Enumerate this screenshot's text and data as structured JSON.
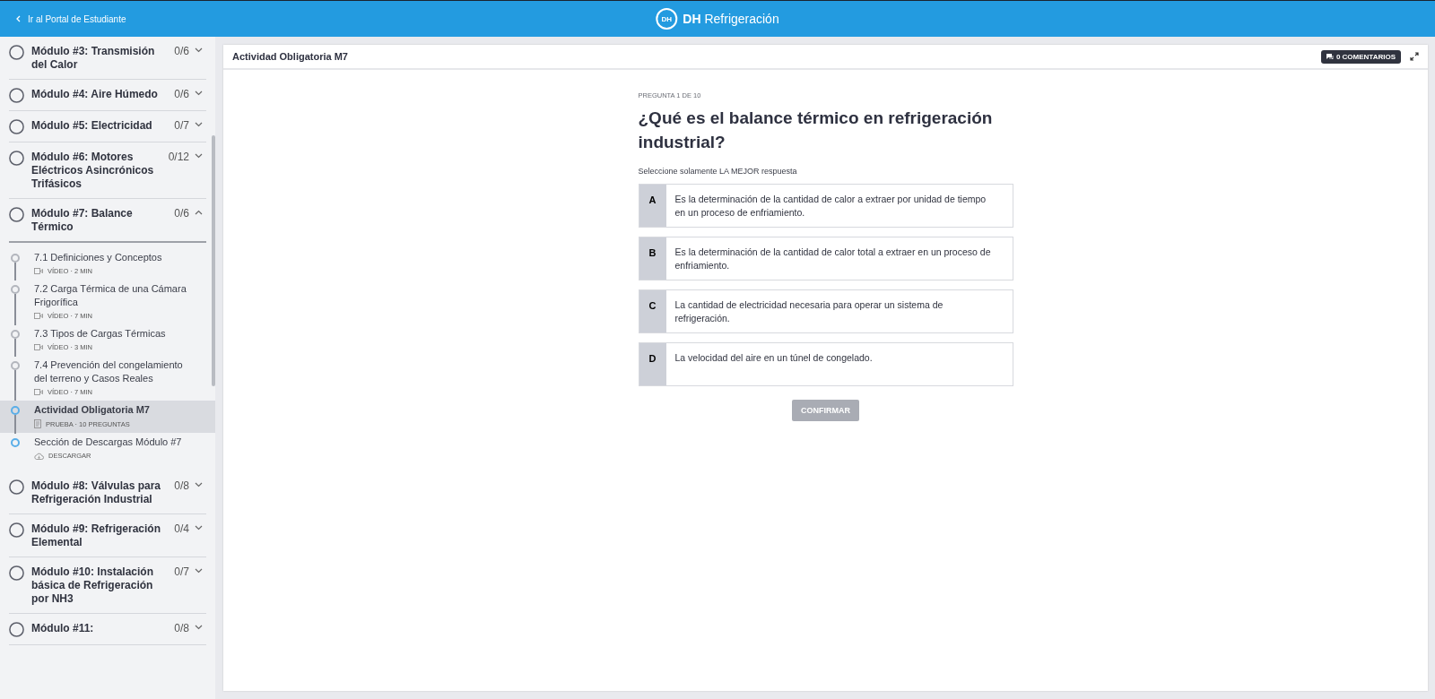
{
  "topbar": {
    "back_link": "Ir al Portal de Estudiante",
    "brand_mark": "DH",
    "brand_bold": "DH",
    "brand_name": "Refrigeración"
  },
  "sidebar": {
    "modules": [
      {
        "title": "Módulo #3: Transmisión del Calor",
        "count": "0/6",
        "level": 0,
        "expanded": false
      },
      {
        "title": "Módulo #4: Aire Húmedo",
        "count": "0/6",
        "level": 0,
        "expanded": false
      },
      {
        "title": "Módulo #5: Electricidad",
        "count": "0/7",
        "level": 0,
        "expanded": false
      },
      {
        "title": "Módulo #6: Motores Eléctricos Asincrónicos Trifásicos",
        "count": "0/12",
        "level": 0,
        "expanded": false
      },
      {
        "title": "Módulo #7: Balance Térmico",
        "count": "0/6",
        "level": 0,
        "expanded": true,
        "children": [
          {
            "kind": "video",
            "title": "7.1 Definiciones y Conceptos",
            "meta": "VÍDEO · 2 MIN",
            "selected": false,
            "color": "#b3b6bd"
          },
          {
            "kind": "video",
            "title": "7.2 Carga Térmica de una Cámara Frigorífica",
            "meta": "VÍDEO · 7 MIN",
            "selected": false,
            "color": "#b3b6bd"
          },
          {
            "kind": "video",
            "title": "7.3 Tipos de Cargas Térmicas",
            "meta": "VÍDEO · 3 MIN",
            "selected": false,
            "color": "#b3b6bd"
          },
          {
            "kind": "video",
            "title": "7.4 Prevención del congelamiento del terreno y Casos Reales",
            "meta": "VÍDEO · 7 MIN",
            "selected": false,
            "color": "#b3b6bd"
          },
          {
            "kind": "quiz",
            "title": "Actividad Obligatoria M7",
            "meta": "PRUEBA · 10 PREGUNTAS",
            "selected": true,
            "color": "#5aaee8"
          },
          {
            "kind": "download",
            "title": "Sección de Descargas Módulo #7",
            "meta": "DESCARGAR",
            "selected": false,
            "color": "#5aaee8"
          }
        ]
      },
      {
        "title": "Módulo #8: Válvulas para Refrigeración Industrial",
        "count": "0/8",
        "level": 0,
        "expanded": false
      },
      {
        "title": "Módulo #9: Refrigeración Elemental",
        "count": "0/4",
        "level": 0,
        "expanded": false
      },
      {
        "title": "Módulo #10: Instalación básica de Refrigeración por NH3",
        "count": "0/7",
        "level": 0,
        "expanded": false
      },
      {
        "title": "Módulo #11:",
        "count": "0/8",
        "level": 0,
        "expanded": false
      }
    ]
  },
  "content": {
    "title": "Actividad Obligatoria M7",
    "comments_button": "0 COMENTARIOS",
    "quiz": {
      "progress": "PREGUNTA 1 DE 10",
      "question": "¿Qué es el balance térmico en refrigeración industrial?",
      "instruction": "Seleccione solamente LA MEJOR respuesta",
      "options": [
        {
          "letter": "A",
          "text": "Es la determinación de la cantidad de calor a extraer por unidad de tiempo en un proceso de enfriamiento.",
          "selected": false
        },
        {
          "letter": "B",
          "text": "Es la determinación de la cantidad de calor total a extraer en un proceso de enfriamiento.",
          "selected": false
        },
        {
          "letter": "C",
          "text": "La cantidad de electricidad necesaria para operar un sistema de refrigeración.",
          "selected": false
        },
        {
          "letter": "D",
          "text": "La velocidad del aire en un túnel de congelado.",
          "selected": false
        }
      ],
      "confirm_button": {
        "label": "CONFIRMAR",
        "disabled": true
      }
    }
  }
}
